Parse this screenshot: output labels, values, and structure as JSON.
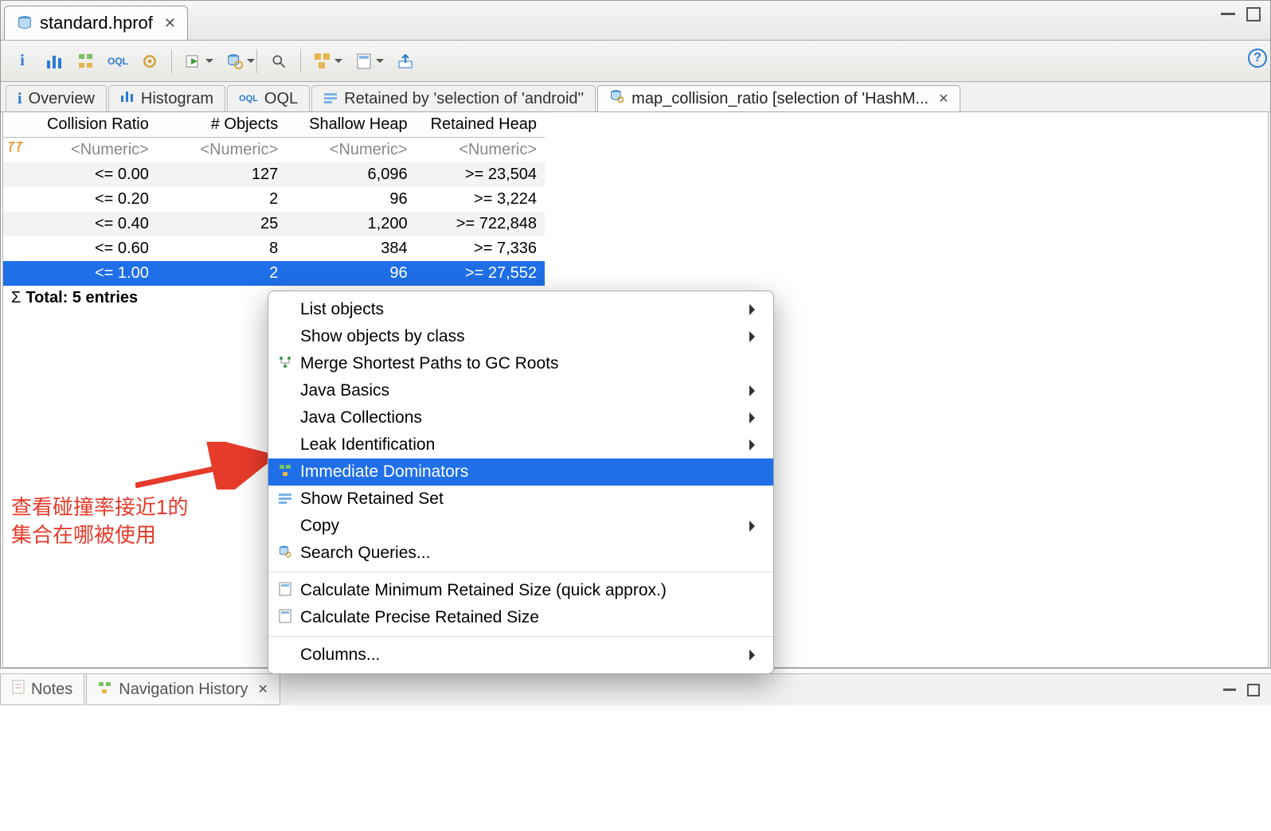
{
  "file_tab": {
    "title": "standard.hprof"
  },
  "inner_tabs": [
    {
      "label": "Overview"
    },
    {
      "label": "Histogram"
    },
    {
      "label": "OQL"
    },
    {
      "label": "Retained by 'selection of 'android''"
    },
    {
      "label": "map_collision_ratio [selection of 'HashM..."
    }
  ],
  "columns": {
    "c0": "Collision Ratio",
    "c1": "# Objects",
    "c2": "Shallow Heap",
    "c3": "Retained Heap"
  },
  "filter_placeholder": "<Numeric>",
  "rows": [
    {
      "c0": "<= 0.00",
      "c1": "127",
      "c2": "6,096",
      "c3": ">= 23,504"
    },
    {
      "c0": "<= 0.20",
      "c1": "2",
      "c2": "96",
      "c3": ">= 3,224"
    },
    {
      "c0": "<= 0.40",
      "c1": "25",
      "c2": "1,200",
      "c3": ">= 722,848"
    },
    {
      "c0": "<= 0.60",
      "c1": "8",
      "c2": "384",
      "c3": ">= 7,336"
    },
    {
      "c0": "<= 1.00",
      "c1": "2",
      "c2": "96",
      "c3": ">= 27,552"
    }
  ],
  "total_label": "Total: 5 entries",
  "context_menu": {
    "items": [
      {
        "label": "List objects",
        "submenu": true
      },
      {
        "label": "Show objects by class",
        "submenu": true
      },
      {
        "label": "Merge Shortest Paths to GC Roots",
        "icon": "tree"
      },
      {
        "label": "Java Basics",
        "submenu": true
      },
      {
        "label": "Java Collections",
        "submenu": true
      },
      {
        "label": "Leak Identification",
        "submenu": true
      },
      {
        "label": "Immediate Dominators",
        "highlight": true,
        "icon": "dom"
      },
      {
        "label": "Show Retained Set",
        "icon": "ret"
      },
      {
        "label": "Copy",
        "submenu": true
      },
      {
        "label": "Search Queries...",
        "icon": "dbgear"
      },
      {
        "sep": true
      },
      {
        "label": "Calculate Minimum Retained Size (quick approx.)",
        "icon": "calc"
      },
      {
        "label": "Calculate Precise Retained Size",
        "icon": "calc"
      },
      {
        "sep": true
      },
      {
        "label": "Columns...",
        "submenu": true
      }
    ]
  },
  "annotation": {
    "line1": "查看碰撞率接近1的",
    "line2": "集合在哪被使用"
  },
  "bottom_tabs": [
    {
      "label": "Notes"
    },
    {
      "label": "Navigation History"
    }
  ],
  "watermark": ""
}
